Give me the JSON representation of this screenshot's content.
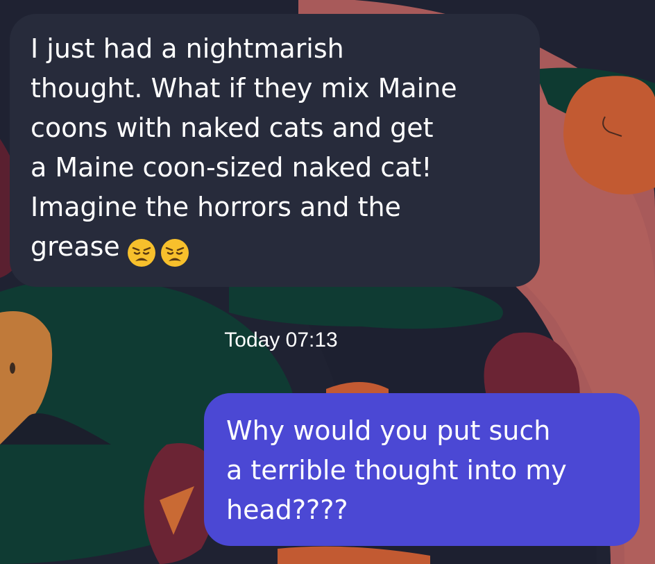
{
  "conversation": {
    "incoming": {
      "text": "I just had a nightmarish\nthought. What if they mix Maine\ncoons with naked cats and get\na Maine coon-sized naked cat!\nImagine the horrors and the\ngrease",
      "emojis": [
        "weary-face-emoji",
        "weary-face-emoji"
      ]
    },
    "timestamp": "Today 07:13",
    "outgoing": {
      "text": "Why would you put such\na terrible thought into my\nhead????"
    }
  },
  "colors": {
    "background": "#1f2232",
    "incoming_bubble": "#272b3b",
    "outgoing_bubble": "#4b48d4",
    "text": "#ffffff"
  }
}
